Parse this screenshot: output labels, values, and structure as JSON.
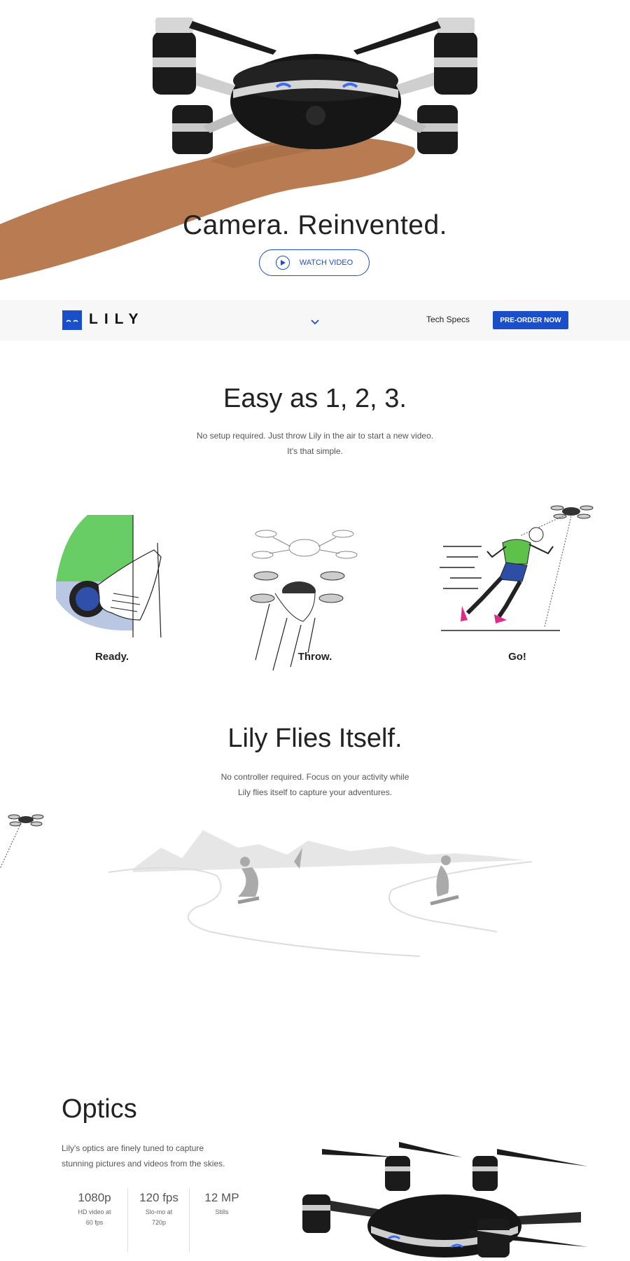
{
  "hero": {
    "title": "Camera. Reinvented.",
    "watch_label": "WATCH VIDEO"
  },
  "nav": {
    "logo_text": "LILY",
    "tech_specs": "Tech Specs",
    "preorder": "PRE-ORDER NOW"
  },
  "easy": {
    "title": "Easy as 1, 2, 3.",
    "line1": "No setup required. Just throw Lily in the air to start a new video.",
    "line2": "It's that simple.",
    "steps": [
      "Ready.",
      "Throw.",
      "Go!"
    ]
  },
  "flies": {
    "title": "Lily Flies Itself.",
    "line1": "No controller required. Focus on your activity while",
    "line2": "Lily flies itself to capture your adventures."
  },
  "optics": {
    "title": "Optics",
    "line1": "Lily's optics are finely tuned to capture",
    "line2": "stunning pictures and videos from the skies.",
    "specs": [
      {
        "value": "1080p",
        "note1": "HD video at",
        "note2": "60 fps"
      },
      {
        "value": "120 fps",
        "note1": "Slo-mo at",
        "note2": "720p"
      },
      {
        "value": "12 MP",
        "note1": "Stills",
        "note2": ""
      }
    ]
  },
  "colors": {
    "accent": "#1a4fc9",
    "nav_bg": "#f7f7f7"
  }
}
